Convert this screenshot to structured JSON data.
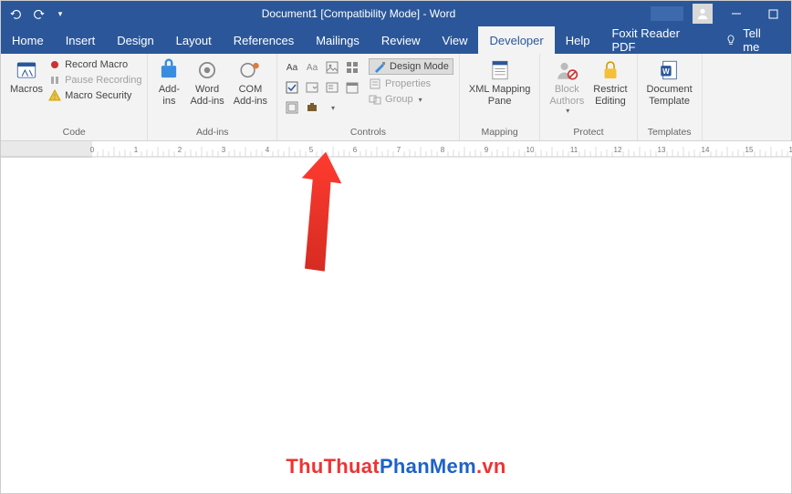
{
  "title": "Document1 [Compatibility Mode] - Word",
  "tabs": {
    "home": "Home",
    "insert": "Insert",
    "design": "Design",
    "layout": "Layout",
    "references": "References",
    "mailings": "Mailings",
    "review": "Review",
    "view": "View",
    "developer": "Developer",
    "help": "Help",
    "foxit": "Foxit Reader PDF",
    "tell": "Tell me"
  },
  "ribbon": {
    "code": {
      "label": "Code",
      "macros": "Macros",
      "record": "Record Macro",
      "pause": "Pause Recording",
      "security": "Macro Security"
    },
    "addins": {
      "label": "Add-ins",
      "addins": "Add-\nins",
      "word": "Word\nAdd-ins",
      "com": "COM\nAdd-ins"
    },
    "controls": {
      "label": "Controls",
      "design": "Design Mode",
      "properties": "Properties",
      "group": "Group"
    },
    "mapping": {
      "label": "Mapping",
      "xml": "XML Mapping\nPane"
    },
    "protect": {
      "label": "Protect",
      "block": "Block\nAuthors",
      "restrict": "Restrict\nEditing"
    },
    "templates": {
      "label": "Templates",
      "doc": "Document\nTemplate"
    }
  },
  "watermark": {
    "a": "ThuThuat",
    "b": "PhanMem",
    "c": ".vn"
  }
}
